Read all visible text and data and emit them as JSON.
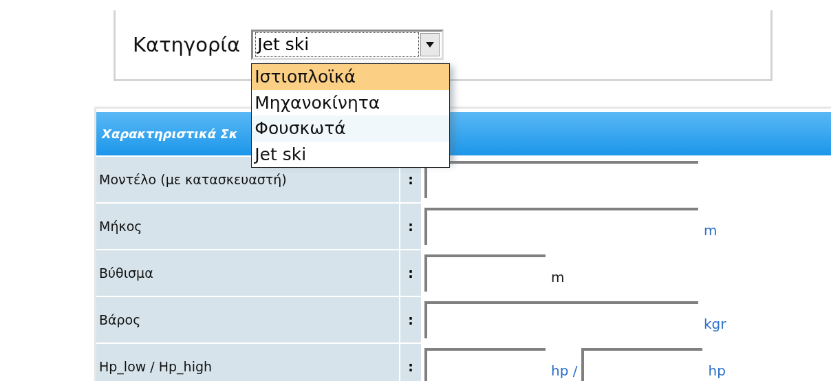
{
  "category": {
    "label": "Κατηγορία",
    "value": "Jet ski",
    "expanded": true,
    "options": [
      {
        "label": "Ιστιοπλοϊκά",
        "highlighted": true
      },
      {
        "label": "Μηχανοκίνητα",
        "highlighted": false
      },
      {
        "label": "Φουσκωτά",
        "highlighted": false
      },
      {
        "label": "Jet ski",
        "highlighted": false
      }
    ]
  },
  "table": {
    "title": "Χαρακτηριστικά Σκ",
    "rows": [
      {
        "label": "Μοντέλο (με κατασκευαστή)",
        "separator": ":",
        "fields": [
          {
            "kind": "wide"
          }
        ]
      },
      {
        "label": "Μήκος",
        "separator": ":",
        "fields": [
          {
            "kind": "wide",
            "unit": "m",
            "color": "#2a6fc9"
          }
        ]
      },
      {
        "label": "Βύθισμα",
        "separator": ":",
        "fields": [
          {
            "kind": "narrow",
            "unit": "m",
            "color": "#1a1a1a"
          }
        ]
      },
      {
        "label": "Βάρος",
        "separator": ":",
        "fields": [
          {
            "kind": "wide",
            "unit": "kgr",
            "color": "#2a6fc9"
          }
        ]
      },
      {
        "label": "Hp_low / Hp_high",
        "separator": ":",
        "fields": [
          {
            "kind": "narrow",
            "unit": "hp /",
            "color": "#2a6fc9"
          },
          {
            "kind": "narrow",
            "unit": "hp",
            "color": "#2a6fc9"
          }
        ]
      }
    ]
  }
}
